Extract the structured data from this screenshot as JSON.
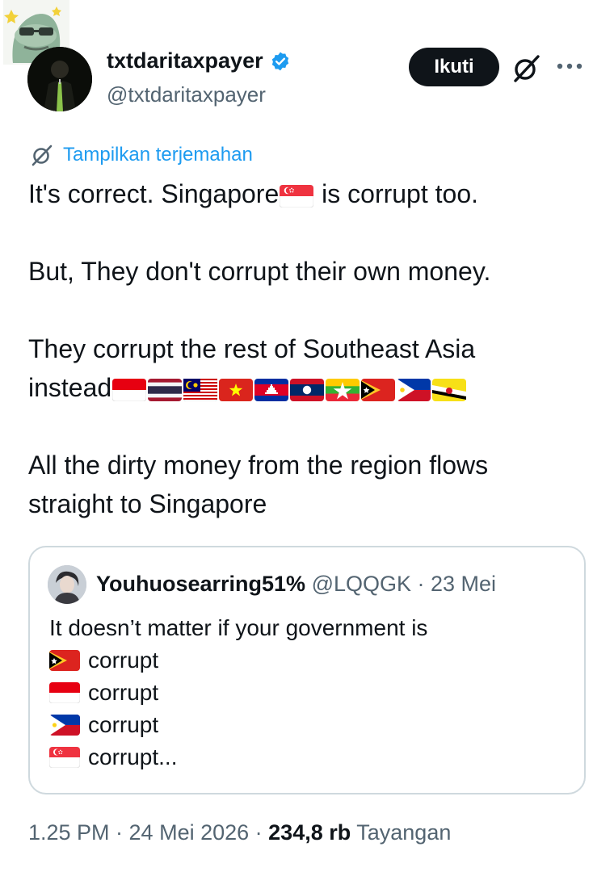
{
  "author": {
    "display_name": "txtdaritaxpayer",
    "handle": "@txtdaritaxpayer",
    "verified": true
  },
  "actions": {
    "follow_label": "Ikuti",
    "grok_icon": "grok-icon",
    "more_icon": "more-icon"
  },
  "translate_label": "Tampilkan terjemahan",
  "tweet": {
    "line1_a": "It's correct. Singapore",
    "line1_b": " is corrupt too.",
    "line2": "But, They don't corrupt their own money.",
    "line3": "They corrupt the rest of Southeast Asia",
    "line4": "instead",
    "line5": "All the dirty money from the region flows",
    "line6": "straight to Singapore",
    "flags": [
      "indonesia",
      "thailand",
      "malaysia",
      "vietnam",
      "cambodia",
      "laos",
      "myanmar",
      "timor-leste",
      "philippines",
      "brunei"
    ]
  },
  "quote": {
    "display_name": "Youhuosearring51%",
    "meta": " @LQQGK · 23 Mei",
    "text": "It doesn’t matter if your government is",
    "lines": [
      {
        "flag": "timor-leste",
        "text": "corrupt"
      },
      {
        "flag": "indonesia",
        "text": "corrupt"
      },
      {
        "flag": "philippines",
        "text": "corrupt"
      },
      {
        "flag": "singapore",
        "text": "corrupt..."
      }
    ]
  },
  "footer": {
    "time": "1.25 PM · 24 Mei 2026 · ",
    "views": "234,8 rb",
    "views_label": " Tayangan"
  },
  "colors": {
    "link": "#1d9bf0",
    "muted": "#536471",
    "border": "#cfd9de",
    "button": "#0f1419"
  }
}
